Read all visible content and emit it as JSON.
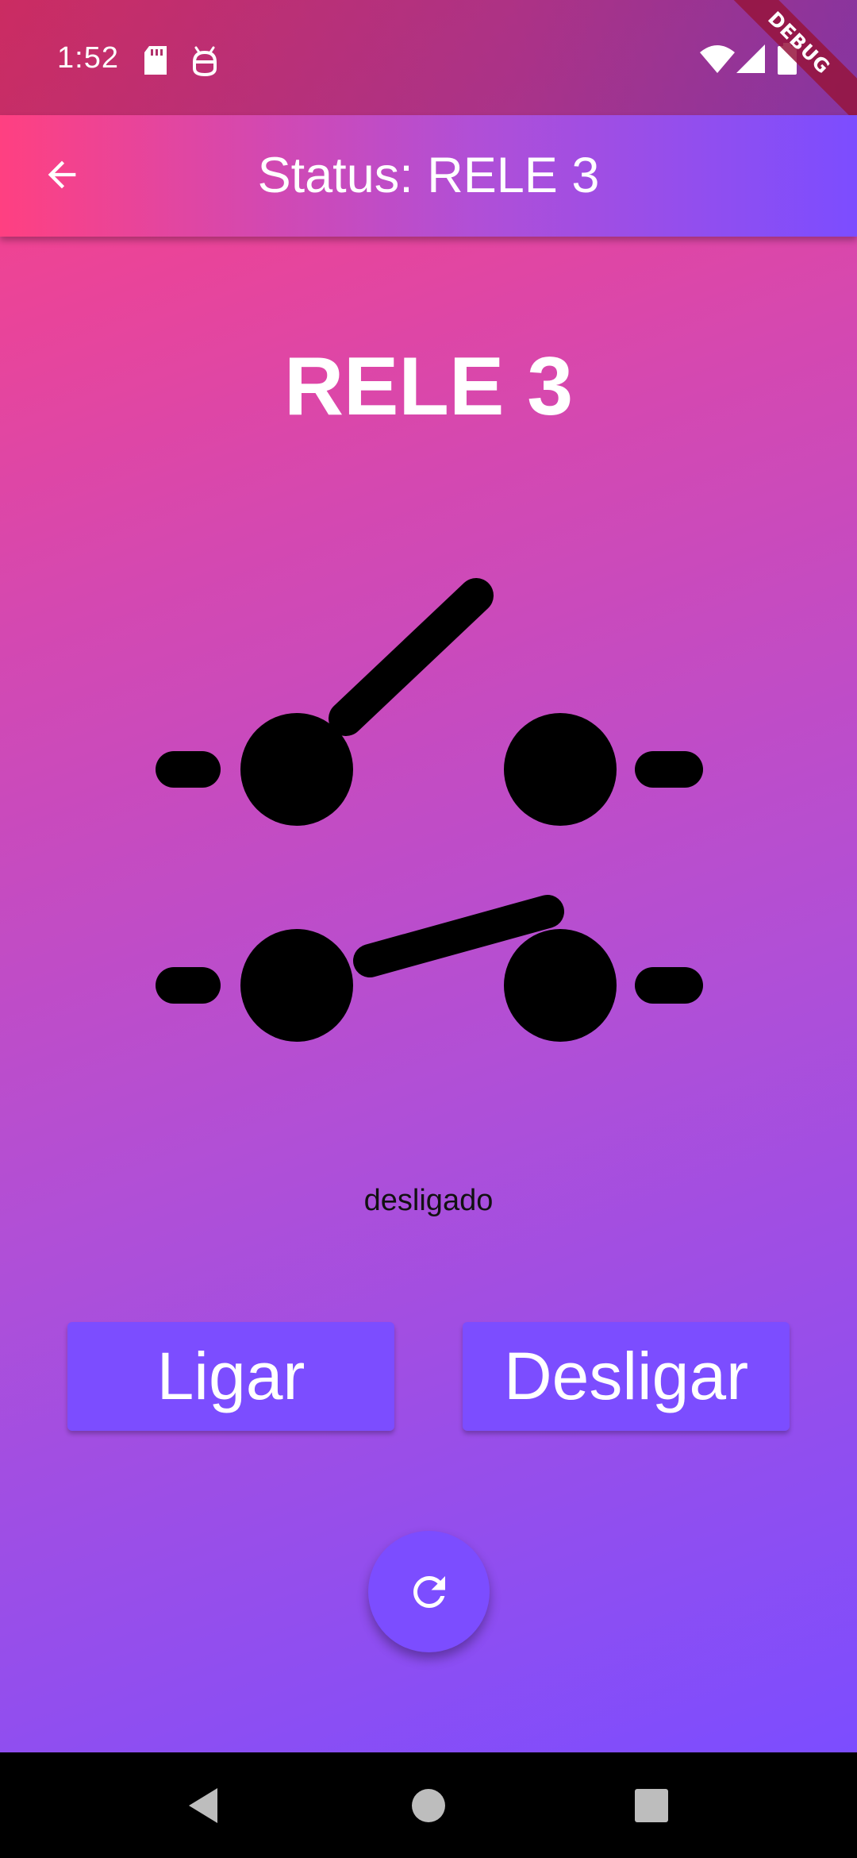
{
  "status_bar": {
    "time": "1:52",
    "icons": [
      "sd-card-icon",
      "android-debug-icon",
      "wifi-icon",
      "signal-icon",
      "battery-icon"
    ],
    "debug_banner": "DEBUG"
  },
  "app_bar": {
    "back_icon": "arrow-back-icon",
    "title": "Status: RELE 3"
  },
  "relay": {
    "name": "RELE 3",
    "state": "desligado",
    "illustration_icons": [
      "switch-open-icon",
      "switch-closed-icon"
    ]
  },
  "actions": {
    "on_label": "Ligar",
    "off_label": "Desligar",
    "refresh_icon": "refresh-icon"
  },
  "nav_bar": {
    "icons": [
      "nav-back-icon",
      "nav-home-icon",
      "nav-recents-icon"
    ]
  },
  "colors": {
    "gradient_start": "#ff4081",
    "gradient_end": "#7c4dff",
    "button": "#7c4dff",
    "text_light": "#ffffff",
    "text_dark": "#111111"
  }
}
